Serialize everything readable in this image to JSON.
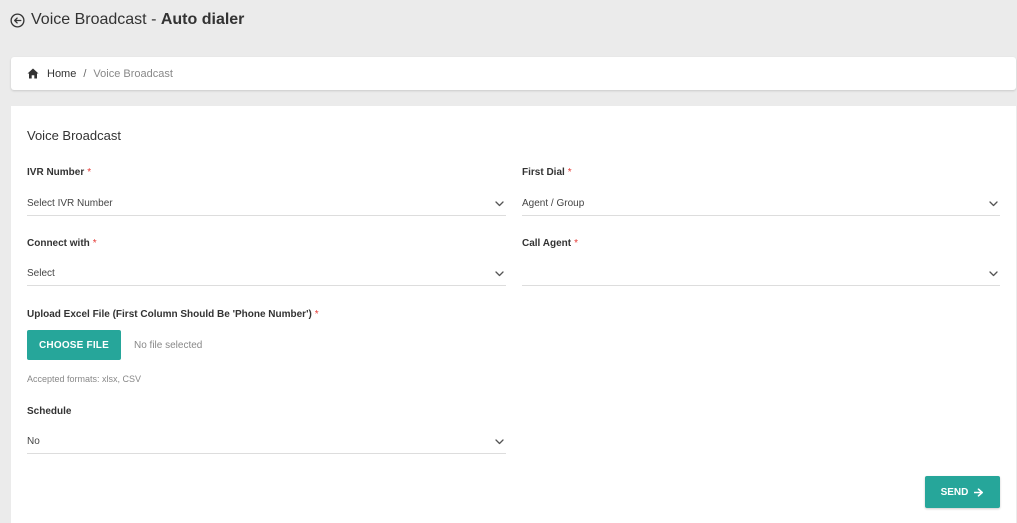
{
  "header": {
    "title_prefix": "Voice Broadcast - ",
    "title_bold": "Auto dialer"
  },
  "breadcrumb": {
    "home": "Home",
    "separator": "/",
    "current": "Voice Broadcast"
  },
  "form": {
    "title": "Voice Broadcast",
    "required_mark": "*",
    "ivr_number": {
      "label": "IVR Number",
      "value": "Select IVR Number"
    },
    "first_dial": {
      "label": "First Dial",
      "value": "Agent / Group"
    },
    "connect_with": {
      "label": "Connect with",
      "value": "Select"
    },
    "call_agent": {
      "label": "Call Agent",
      "value": ""
    },
    "upload": {
      "label": "Upload Excel File (First Column Should Be 'Phone Number')",
      "button": "CHOOSE FILE",
      "status": "No file selected",
      "accepted": "Accepted formats: xlsx, CSV"
    },
    "schedule": {
      "label": "Schedule",
      "value": "No"
    },
    "send_button": "SEND"
  },
  "colors": {
    "accent": "#26a69a",
    "required": "#e53935",
    "background": "#ebebeb"
  },
  "icons": {
    "back": "arrow-left-circle-icon",
    "home": "home-icon",
    "chevron": "chevron-down-icon",
    "send_arrow": "arrow-right-icon"
  }
}
